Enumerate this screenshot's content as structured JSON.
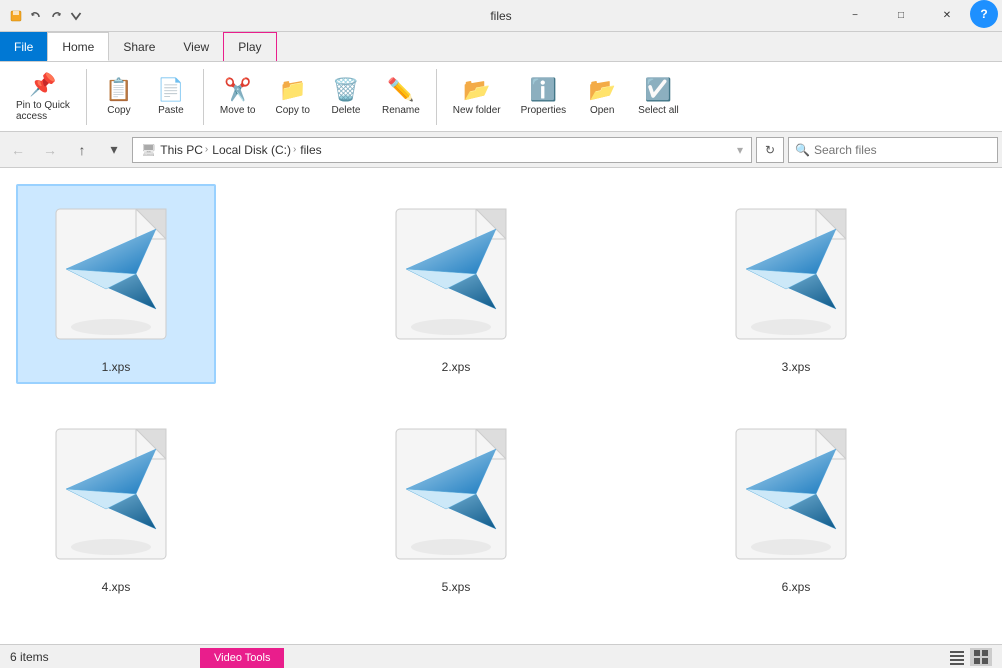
{
  "titlebar": {
    "title": "files",
    "tabs": [
      {
        "id": "video-tools",
        "label": "Video Tools",
        "active": false,
        "color": "#e91e8c"
      }
    ],
    "window_controls": {
      "minimize": "−",
      "maximize": "□",
      "close": "✕"
    }
  },
  "ribbon": {
    "tabs": [
      {
        "id": "file",
        "label": "File",
        "active": false
      },
      {
        "id": "home",
        "label": "Home",
        "active": true
      },
      {
        "id": "share",
        "label": "Share",
        "active": false
      },
      {
        "id": "view",
        "label": "View",
        "active": false
      },
      {
        "id": "play",
        "label": "Play",
        "active": false
      }
    ]
  },
  "addressbar": {
    "path_parts": [
      "This PC",
      "Local Disk (C:)",
      "files"
    ],
    "search_placeholder": "Search files",
    "search_label": "Search",
    "refresh_icon": "↻",
    "dropdown_icon": "▾"
  },
  "files": [
    {
      "id": "file1",
      "name": "1.xps",
      "selected": true
    },
    {
      "id": "file2",
      "name": "2.xps",
      "selected": false
    },
    {
      "id": "file3",
      "name": "3.xps",
      "selected": false
    },
    {
      "id": "file4",
      "name": "4.xps",
      "selected": false
    },
    {
      "id": "file5",
      "name": "5.xps",
      "selected": false
    },
    {
      "id": "file6",
      "name": "6.xps",
      "selected": false
    }
  ],
  "statusbar": {
    "count_label": "6 items",
    "view_icons": [
      "list",
      "details"
    ]
  }
}
